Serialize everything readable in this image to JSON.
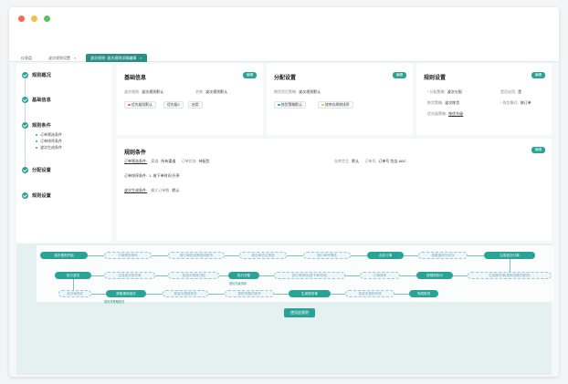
{
  "window": {
    "colors": {
      "red": "#ef6c5a",
      "yellow": "#f4be4f",
      "green": "#5ac35f",
      "accent": "#2aa396"
    }
  },
  "tabs": [
    {
      "label": "仪表盘",
      "active": false,
      "closable": false
    },
    {
      "label": "波次规则设置",
      "active": false,
      "closable": true
    },
    {
      "label": "波次规则: 波次规则详情编辑",
      "active": true,
      "closable": true
    }
  ],
  "steps": [
    {
      "label": "规则概况"
    },
    {
      "label": "基础信息"
    },
    {
      "label": "规则条件"
    },
    {
      "label": "分配设置"
    },
    {
      "label": "规则设置"
    }
  ],
  "substeps": [
    "订单筛选条件",
    "订单排序条件",
    "波次生成条件"
  ],
  "basic": {
    "title": "基础信息",
    "edit": "编辑",
    "f1_label": "波次规则:",
    "f1_value": "波次规则默认",
    "f2_label": "名称:",
    "f2_value": "波次规则默认",
    "chips": [
      "优先级别默认",
      "优先级3",
      "启用"
    ]
  },
  "alloc": {
    "title": "分配设置",
    "edit": "编辑",
    "f1_label": "物资货位策略:",
    "f1_value": "波次规则默认",
    "chips": [
      "拣货策略默认",
      "按库存周转排序"
    ]
  },
  "rule": {
    "title": "规则设置",
    "edit": "编辑",
    "f1_label": "* 分配策略:",
    "f1_value": "波次分配",
    "f2_label": "是否启用:",
    "f2_value": "是",
    "f3_label": "拣货策略:",
    "f3_value": "波次拣货",
    "f4_label": "* 拣货模式:",
    "f4_value": "按订单",
    "f5_label": "优先级策略:",
    "f5_value": "按优先级"
  },
  "cond": {
    "title": "规则条件",
    "edit": "编辑",
    "r1_label": "订单筛选条件:",
    "r1_a": "渠道:",
    "r1_a_v": "所有渠道",
    "r1_b": "订单状态:",
    "r1_b_v": "待配货",
    "r1_c": "仓库货主:",
    "r1_c_v": "默认",
    "r1_d": "订单号:",
    "r1_d_v": "订单号 包含 ABC",
    "r2_label": "订单排序条件:",
    "r2_value": "1. 按下单时间 升序",
    "r3_label": "波次生成条件:",
    "r3_a": "最大订单数:",
    "r3_a_v": "默认"
  },
  "flow": {
    "row1": [
      "波次规则开始",
      "订单筛选条件",
      "按订单状态筛选待配货",
      "按仓库货主筛选",
      "按订单号筛选",
      "合并订单",
      "按渠道拆分波次",
      "生成波次订单"
    ],
    "row2": [
      "执行波次",
      "生成波次拣货单",
      "按波次规则分配",
      "执行分配",
      "按订单排序(按下单时间)",
      "订单排序",
      "按规则拆分",
      "生成拣货单(按拣货模式拣货)"
    ],
    "row2_sub": "按优先级排序",
    "row3": [
      "波次单完成",
      "获取规则波次",
      "按波次规则拣货",
      "按拣货模式拣货",
      "生成拣货单",
      "按波次规则完成",
      "完成拣货"
    ],
    "row3_sub": "按拣货策略拣货",
    "use_button": "使用此规则"
  }
}
